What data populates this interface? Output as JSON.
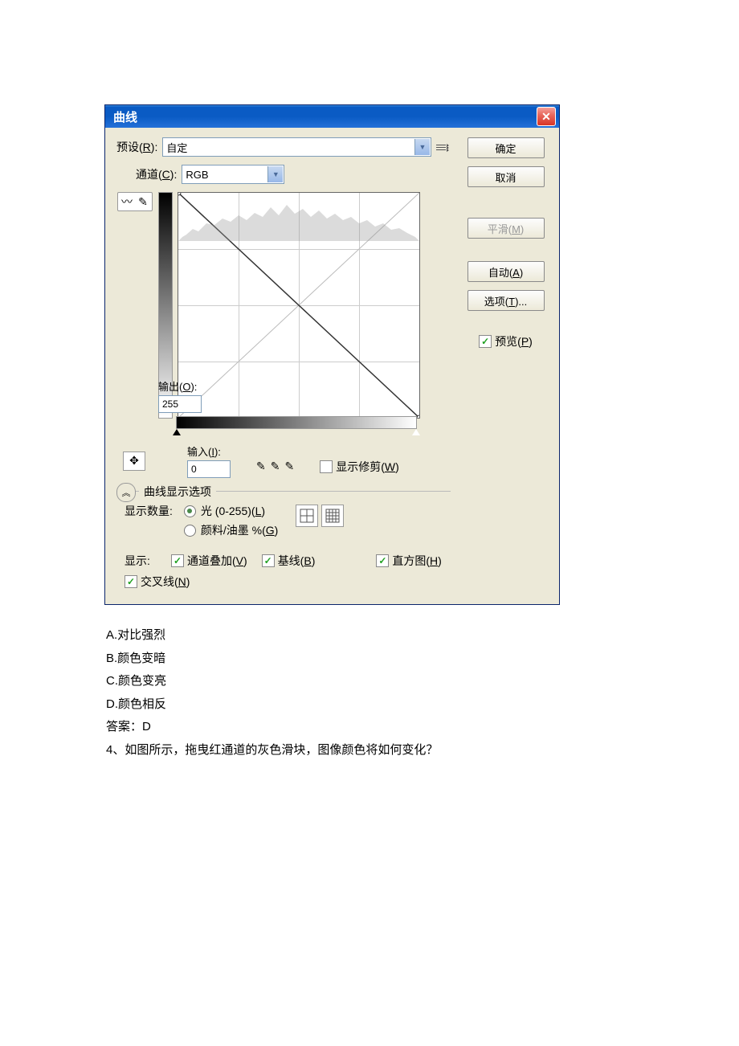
{
  "dialog": {
    "title": "曲线"
  },
  "preset": {
    "label": "预设(",
    "key": "R",
    "value": "自定"
  },
  "channel": {
    "label": "通道(",
    "key": "C",
    "value": "RGB"
  },
  "buttons": {
    "ok": "确定",
    "cancel": "取消",
    "smooth": "平滑(",
    "smooth_key": "M",
    "auto": "自动(",
    "auto_key": "A",
    "options": "选项(",
    "options_key": "T",
    "options_suffix": ")..."
  },
  "preview": {
    "label": "预览(",
    "key": "P"
  },
  "output": {
    "label": "输出(",
    "key": "O",
    "value": "255"
  },
  "input": {
    "label": "输入(",
    "key": "I",
    "value": "0"
  },
  "clip": {
    "label": "显示修剪(",
    "key": "W"
  },
  "display_opts": "曲线显示选项",
  "amount": {
    "label": "显示数量:",
    "light": "光 (0-255)(",
    "light_key": "L",
    "ink": "颜料/油墨 %(",
    "ink_key": "G"
  },
  "show": {
    "label": "显示:",
    "overlay": "通道叠加(",
    "overlay_key": "V",
    "baseline": "基线(",
    "baseline_key": "B",
    "histogram": "直方图(",
    "histogram_key": "H",
    "cross": "交叉线(",
    "cross_key": "N"
  },
  "question": {
    "a": "A.对比强烈",
    "b": "B.颜色变暗",
    "c": "C.颜色变亮",
    "d": "D.颜色相反",
    "answer": "答案：D",
    "q4": "4、如图所示，拖曳红通道的灰色滑块，图像颜色将如何变化？"
  }
}
